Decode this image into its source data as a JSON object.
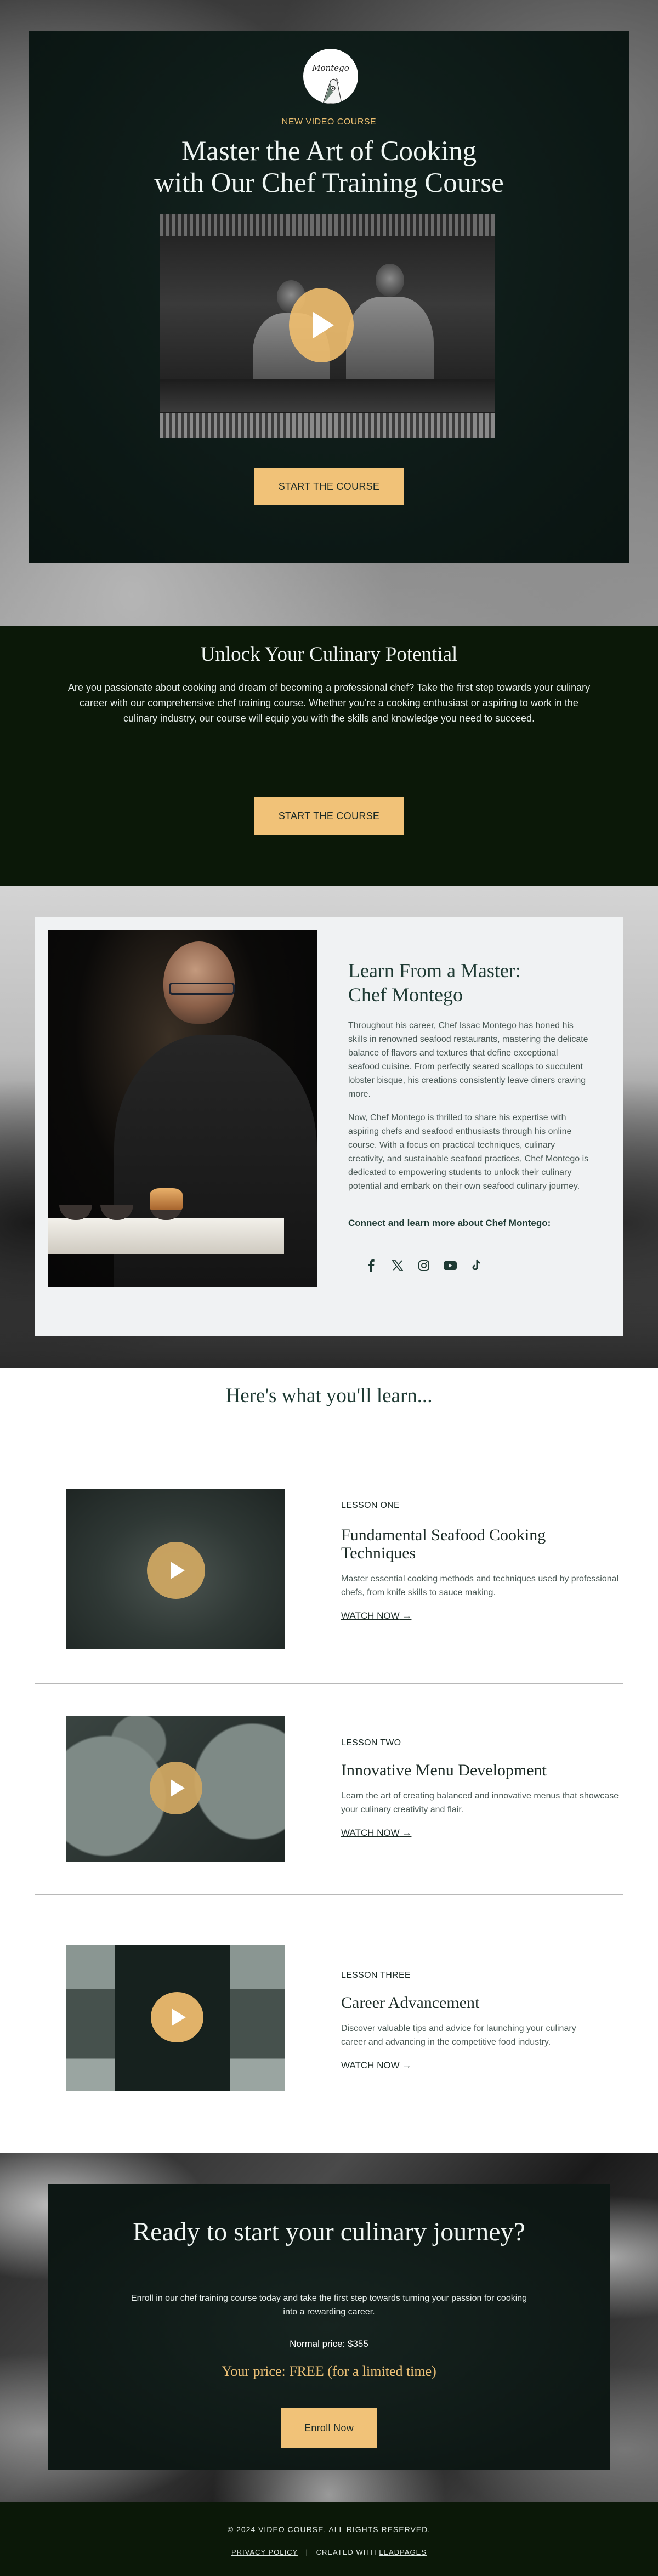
{
  "colors": {
    "accent_gold": "#f1c278",
    "dark_green": "#0b1808",
    "panel_green": "#0c1815",
    "heading_green": "#1e3a33",
    "card_bg": "#f0f2f3"
  },
  "hero": {
    "logo_text": "Montego",
    "eyebrow": "NEW VIDEO COURSE",
    "title_line1": "Master the Art of Cooking",
    "title_line2": "with Our Chef Training Course",
    "video_play_icon": "play-icon",
    "cta_label": "START THE COURSE"
  },
  "unlock": {
    "title": "Unlock Your Culinary Potential",
    "body": "Are you passionate about cooking and dream of becoming a professional chef? Take the first step towards your culinary career with our comprehensive chef training course. Whether you're a cooking enthusiast or aspiring to work in the culinary industry, our course will equip you with the skills and knowledge you need to succeed.",
    "cta_label": "START THE COURSE"
  },
  "chef": {
    "title_line1": "Learn From a Master:",
    "title_line2": "Chef Montego",
    "paragraph1": "Throughout his career, Chef Issac Montego has honed his skills in renowned seafood restaurants, mastering the delicate balance of flavors and textures that define exceptional seafood cuisine. From perfectly seared scallops to succulent lobster bisque, his creations consistently leave diners craving more.",
    "paragraph2": "Now, Chef Montego is thrilled to share his expertise with aspiring chefs and seafood enthusiasts through his online course. With a focus on practical techniques, culinary creativity, and sustainable seafood practices, Chef Montego is dedicated to empowering students to unlock their culinary potential and embark on their own seafood culinary journey.",
    "connect_label": "Connect and learn more about Chef Montego:",
    "socials": [
      {
        "name": "facebook",
        "icon": "facebook-icon"
      },
      {
        "name": "x",
        "icon": "x-icon"
      },
      {
        "name": "instagram",
        "icon": "instagram-icon"
      },
      {
        "name": "youtube",
        "icon": "youtube-icon"
      },
      {
        "name": "tiktok",
        "icon": "tiktok-icon"
      }
    ]
  },
  "lessons": {
    "title": "Here's what you'll learn...",
    "items": [
      {
        "number": "LESSON ONE",
        "title": "Fundamental Seafood Cooking Techniques",
        "description": "Master essential cooking methods and techniques used by professional chefs, from knife skills to sauce making.",
        "link_label": "WATCH NOW",
        "link_arrow": "→"
      },
      {
        "number": "LESSON TWO",
        "title": "Innovative Menu Development",
        "description": "Learn the art of creating balanced and innovative menus that showcase your culinary creativity and flair.",
        "link_label": "WATCH NOW",
        "link_arrow": "→"
      },
      {
        "number": "LESSON THREE",
        "title": "Career Advancement",
        "description": "Discover valuable tips and advice for launching your culinary career and advancing in the competitive food industry.",
        "link_label": "WATCH NOW",
        "link_arrow": "→"
      }
    ]
  },
  "cta": {
    "title": "Ready to start your culinary journey?",
    "lead": "Enroll in our chef training course today and take the first step towards turning your passion for cooking into a rewarding career.",
    "normal_price_label": "Normal price:",
    "normal_price_value": "$355",
    "your_price": "Your price: FREE (for a limited time)",
    "button_label": "Enroll Now"
  },
  "footer": {
    "copyright": "© 2024 VIDEO COURSE. ALL RIGHTS RESERVED.",
    "privacy_label": "PRIVACY POLICY",
    "separator": "|",
    "created_with": "CREATED WITH",
    "leadpages_label": "LEADPAGES"
  }
}
